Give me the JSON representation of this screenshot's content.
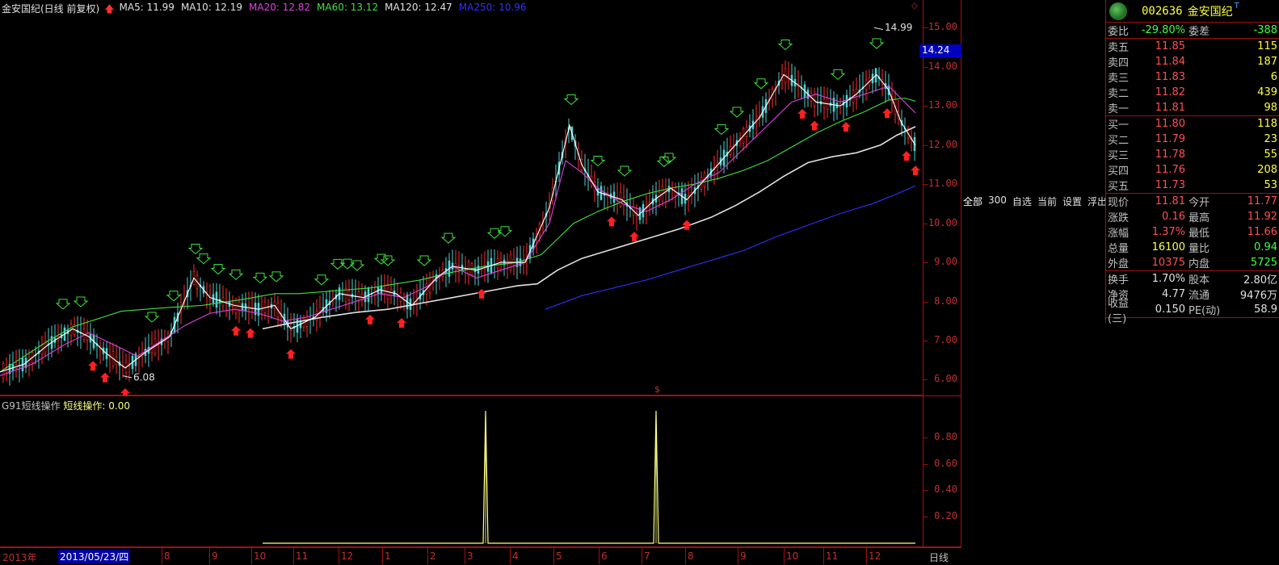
{
  "chart_header": {
    "title": "金安国纪(日线 前复权)",
    "ma_items": [
      {
        "label": "MA5: 11.99",
        "color": "#e0e0e0"
      },
      {
        "label": "MA10: 12.19",
        "color": "#e0e0e0"
      },
      {
        "label": "MA20: 12.82",
        "color": "#e040e0"
      },
      {
        "label": "MA60: 13.12",
        "color": "#40e040"
      },
      {
        "label": "MA120: 12.47",
        "color": "#e0e0e0"
      },
      {
        "label": "MA250: 10.96",
        "color": "#3030ff"
      }
    ]
  },
  "price_axis": {
    "labels": [
      "15.00",
      "14.00",
      "13.00",
      "12.00",
      "11.00",
      "10.00",
      "9.00",
      "8.00",
      "7.00",
      "6.00"
    ],
    "current_tag": "14.24",
    "high_marker": "14.99",
    "low_marker": "6.08"
  },
  "indicator": {
    "name": "G91短线操作",
    "value_text": "短线操作: 0.00",
    "axis_labels": [
      "0.80",
      "0.60",
      "0.40",
      "0.20"
    ]
  },
  "x_axis": {
    "start_label": "2013年",
    "selected_date": "2013/05/23/四",
    "labels": [
      "8",
      "9",
      "10",
      "11",
      "12",
      "1",
      "2",
      "3",
      "4",
      "5",
      "6",
      "7",
      "8",
      "9",
      "10",
      "11",
      "12"
    ],
    "period": "日线"
  },
  "scroll_marker": "$",
  "tabs": [
    "全部",
    "300",
    "自选",
    "当前",
    "设置",
    "浮出",
    "扩"
  ],
  "quote": {
    "code": "002636",
    "name": "金安国纪",
    "t_mark": "T",
    "weibi": {
      "label": "委比",
      "value": "-29.80%",
      "label2": "委差",
      "value2": "-388"
    },
    "sell": [
      {
        "label": "卖五",
        "price": "11.85",
        "qty": "115"
      },
      {
        "label": "卖四",
        "price": "11.84",
        "qty": "187"
      },
      {
        "label": "卖三",
        "price": "11.83",
        "qty": "6"
      },
      {
        "label": "卖二",
        "price": "11.82",
        "qty": "439"
      },
      {
        "label": "卖一",
        "price": "11.81",
        "qty": "98"
      }
    ],
    "buy": [
      {
        "label": "买一",
        "price": "11.80",
        "qty": "118"
      },
      {
        "label": "买二",
        "price": "11.79",
        "qty": "23"
      },
      {
        "label": "买三",
        "price": "11.78",
        "qty": "55"
      },
      {
        "label": "买四",
        "price": "11.76",
        "qty": "208"
      },
      {
        "label": "买五",
        "price": "11.73",
        "qty": "53"
      }
    ],
    "stats1": [
      {
        "l1": "现价",
        "v1": "11.81",
        "c1": "red",
        "l2": "今开",
        "v2": "11.77",
        "c2": "red"
      },
      {
        "l1": "涨跌",
        "v1": "0.16",
        "c1": "red",
        "l2": "最高",
        "v2": "11.92",
        "c2": "red"
      },
      {
        "l1": "涨幅",
        "v1": "1.37%",
        "c1": "red",
        "l2": "最低",
        "v2": "11.66",
        "c2": "red"
      },
      {
        "l1": "总量",
        "v1": "16100",
        "c1": "yellow",
        "l2": "量比",
        "v2": "0.94",
        "c2": "green"
      },
      {
        "l1": "外盘",
        "v1": "10375",
        "c1": "red",
        "l2": "内盘",
        "v2": "5725",
        "c2": "green"
      }
    ],
    "stats2": [
      {
        "l1": "换手",
        "v1": "1.70%",
        "c1": "white",
        "l2": "股本",
        "v2": "2.80亿",
        "c2": "white"
      },
      {
        "l1": "净资",
        "v1": "4.77",
        "c1": "white",
        "l2": "流通",
        "v2": "9476万",
        "c2": "white"
      },
      {
        "l1": "收益(三)",
        "v1": "0.150",
        "c1": "white",
        "l2": "PE(动)",
        "v2": "58.9",
        "c2": "white"
      }
    ]
  },
  "chart_data": {
    "type": "line",
    "price_range": [
      5.7,
      15.5
    ],
    "series": [
      {
        "name": "MA60",
        "color": "#40e040",
        "points": [
          [
            0,
            6.2
          ],
          [
            30,
            6.6
          ],
          [
            60,
            7.0
          ],
          [
            90,
            7.35
          ],
          [
            120,
            7.55
          ],
          [
            150,
            7.75
          ],
          [
            180,
            7.8
          ],
          [
            210,
            7.85
          ],
          [
            250,
            7.9
          ],
          [
            300,
            8.05
          ],
          [
            340,
            8.2
          ],
          [
            370,
            8.2
          ],
          [
            400,
            8.25
          ],
          [
            430,
            8.3
          ],
          [
            460,
            8.35
          ],
          [
            490,
            8.45
          ],
          [
            520,
            8.55
          ],
          [
            560,
            8.75
          ],
          [
            600,
            8.9
          ],
          [
            640,
            9.0
          ],
          [
            670,
            9.2
          ],
          [
            690,
            9.6
          ],
          [
            710,
            10.0
          ],
          [
            740,
            10.3
          ],
          [
            770,
            10.55
          ],
          [
            800,
            10.75
          ],
          [
            830,
            10.9
          ],
          [
            860,
            11.0
          ],
          [
            890,
            11.15
          ],
          [
            920,
            11.35
          ],
          [
            950,
            11.6
          ],
          [
            980,
            11.95
          ],
          [
            1010,
            12.3
          ],
          [
            1040,
            12.6
          ],
          [
            1070,
            12.85
          ],
          [
            1100,
            13.15
          ],
          [
            1120,
            13.2
          ],
          [
            1133,
            13.12
          ]
        ]
      },
      {
        "name": "MA120",
        "color": "#e0e0e0",
        "points": [
          [
            325,
            7.3
          ],
          [
            360,
            7.45
          ],
          [
            400,
            7.6
          ],
          [
            440,
            7.72
          ],
          [
            480,
            7.8
          ],
          [
            520,
            7.95
          ],
          [
            560,
            8.1
          ],
          [
            600,
            8.25
          ],
          [
            640,
            8.4
          ],
          [
            665,
            8.45
          ],
          [
            690,
            8.8
          ],
          [
            720,
            9.1
          ],
          [
            760,
            9.35
          ],
          [
            800,
            9.6
          ],
          [
            840,
            9.85
          ],
          [
            880,
            10.15
          ],
          [
            910,
            10.45
          ],
          [
            940,
            10.8
          ],
          [
            970,
            11.2
          ],
          [
            1000,
            11.55
          ],
          [
            1030,
            11.7
          ],
          [
            1060,
            11.8
          ],
          [
            1090,
            12.0
          ],
          [
            1110,
            12.25
          ],
          [
            1133,
            12.47
          ]
        ]
      },
      {
        "name": "MA250",
        "color": "#3030ff",
        "points": [
          [
            675,
            7.8
          ],
          [
            720,
            8.15
          ],
          [
            760,
            8.35
          ],
          [
            800,
            8.55
          ],
          [
            840,
            8.8
          ],
          [
            880,
            9.05
          ],
          [
            920,
            9.3
          ],
          [
            960,
            9.65
          ],
          [
            1000,
            9.95
          ],
          [
            1040,
            10.25
          ],
          [
            1080,
            10.5
          ],
          [
            1110,
            10.75
          ],
          [
            1133,
            10.96
          ]
        ]
      },
      {
        "name": "MA20",
        "color": "#e040e0",
        "points": [
          [
            0,
            6.1
          ],
          [
            40,
            6.4
          ],
          [
            80,
            6.9
          ],
          [
            110,
            7.2
          ],
          [
            140,
            6.9
          ],
          [
            170,
            6.6
          ],
          [
            200,
            7.0
          ],
          [
            230,
            7.4
          ],
          [
            260,
            7.7
          ],
          [
            290,
            7.8
          ],
          [
            320,
            7.7
          ],
          [
            350,
            7.5
          ],
          [
            380,
            7.6
          ],
          [
            410,
            7.8
          ],
          [
            440,
            8.0
          ],
          [
            470,
            8.2
          ],
          [
            500,
            8.1
          ],
          [
            530,
            8.4
          ],
          [
            560,
            8.9
          ],
          [
            590,
            8.6
          ],
          [
            620,
            8.8
          ],
          [
            650,
            9.0
          ],
          [
            680,
            10.0
          ],
          [
            700,
            11.6
          ],
          [
            720,
            11.3
          ],
          [
            740,
            10.9
          ],
          [
            770,
            10.5
          ],
          [
            800,
            10.3
          ],
          [
            830,
            10.6
          ],
          [
            860,
            11.0
          ],
          [
            890,
            11.3
          ],
          [
            920,
            11.9
          ],
          [
            950,
            12.5
          ],
          [
            980,
            13.1
          ],
          [
            1010,
            13.3
          ],
          [
            1040,
            13.1
          ],
          [
            1070,
            13.3
          ],
          [
            1100,
            13.5
          ],
          [
            1133,
            12.82
          ]
        ]
      },
      {
        "name": "MA5",
        "color": "#ffffff",
        "points": [
          [
            0,
            6.2
          ],
          [
            30,
            6.4
          ],
          [
            60,
            6.9
          ],
          [
            90,
            7.3
          ],
          [
            110,
            7.1
          ],
          [
            130,
            6.7
          ],
          [
            155,
            6.3
          ],
          [
            180,
            6.7
          ],
          [
            210,
            7.1
          ],
          [
            240,
            8.6
          ],
          [
            260,
            8.1
          ],
          [
            290,
            7.9
          ],
          [
            320,
            7.8
          ],
          [
            340,
            7.9
          ],
          [
            360,
            7.3
          ],
          [
            390,
            7.6
          ],
          [
            420,
            8.2
          ],
          [
            450,
            8.1
          ],
          [
            470,
            8.3
          ],
          [
            490,
            8.2
          ],
          [
            510,
            7.9
          ],
          [
            540,
            8.6
          ],
          [
            560,
            8.9
          ],
          [
            590,
            8.8
          ],
          [
            620,
            9.0
          ],
          [
            650,
            9.0
          ],
          [
            680,
            10.4
          ],
          [
            705,
            12.5
          ],
          [
            720,
            11.5
          ],
          [
            740,
            10.8
          ],
          [
            770,
            10.6
          ],
          [
            790,
            10.2
          ],
          [
            810,
            10.6
          ],
          [
            830,
            10.9
          ],
          [
            850,
            10.6
          ],
          [
            880,
            11.3
          ],
          [
            910,
            12.0
          ],
          [
            940,
            12.7
          ],
          [
            970,
            13.8
          ],
          [
            990,
            13.5
          ],
          [
            1010,
            13.1
          ],
          [
            1040,
            13.0
          ],
          [
            1060,
            13.3
          ],
          [
            1085,
            13.8
          ],
          [
            1100,
            13.4
          ],
          [
            1115,
            12.6
          ],
          [
            1133,
            11.99
          ]
        ]
      }
    ],
    "indicator_spikes": [
      {
        "x": 601,
        "value": 1.0
      },
      {
        "x": 812,
        "value": 1.0
      }
    ]
  }
}
